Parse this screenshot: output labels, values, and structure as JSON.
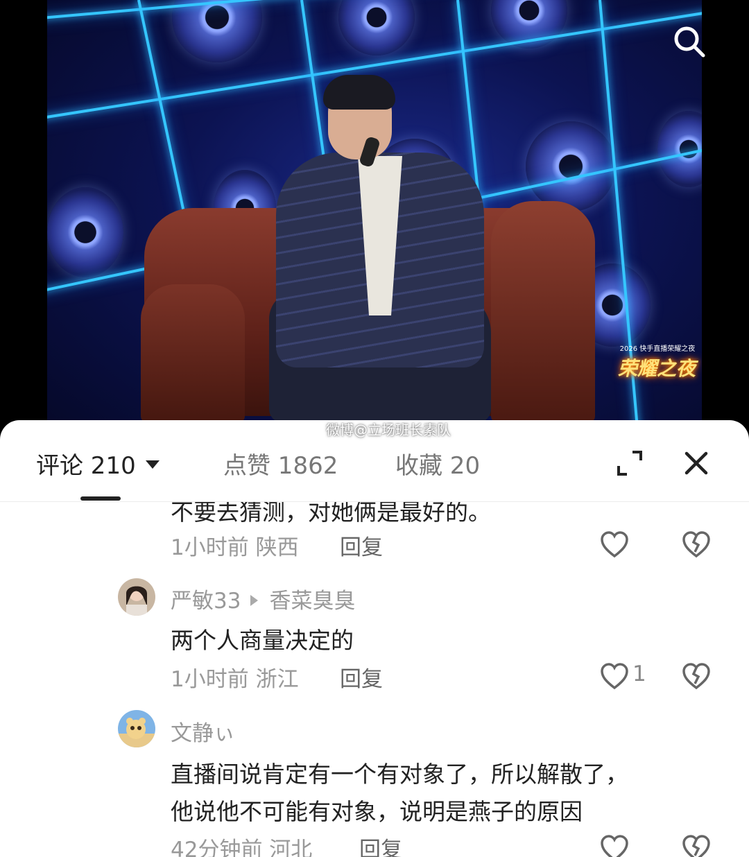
{
  "video": {
    "overlay_top_text": "2026 快手直播荣耀之夜",
    "overlay_logo_text": "荣耀之夜",
    "watermark": "微博@立场班长素队"
  },
  "header": {
    "tabs": [
      {
        "label": "评论 210"
      },
      {
        "label": "点赞 1862"
      },
      {
        "label": "收藏 20"
      }
    ]
  },
  "comments": [
    {
      "text": "不要去猜测，对她俩是最好的。",
      "meta": "1小时前 陕西",
      "reply_label": "回复",
      "likes": ""
    },
    {
      "username": "严敏33",
      "reply_to": "香菜臭臭",
      "text": "两个人商量决定的",
      "meta": "1小时前 浙江",
      "reply_label": "回复",
      "likes": "1"
    },
    {
      "username": "文静ぃ",
      "text_lines": [
        "直播间说肯定有一个有对象了，所以解散了，",
        "他说他不可能有对象，说明是燕子的原因"
      ],
      "meta": "42分钟前 河北",
      "reply_label": "回复",
      "likes": ""
    }
  ],
  "colors": {
    "grid_glow": "#35c6ff",
    "text_primary": "#222222",
    "text_secondary": "#999999"
  }
}
